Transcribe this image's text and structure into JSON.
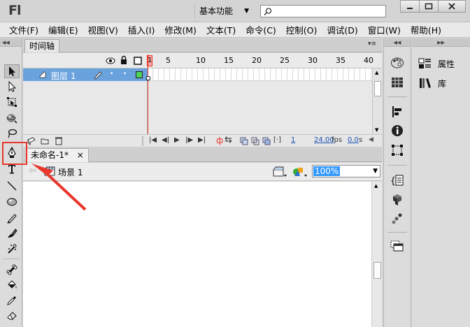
{
  "app": {
    "logo": "Fl"
  },
  "titlebar": {
    "workspace_label": "基本功能",
    "search_placeholder": ""
  },
  "menu": [
    "文件(F)",
    "编辑(E)",
    "视图(V)",
    "插入(I)",
    "修改(M)",
    "文本(T)",
    "命令(C)",
    "控制(O)",
    "调试(D)",
    "窗口(W)",
    "帮助(H)"
  ],
  "timeline": {
    "tab_label": "时间轴",
    "layer_name": "图层 1",
    "frame_ticks": [
      "1",
      "5",
      "10",
      "15",
      "20",
      "25",
      "30",
      "35",
      "40"
    ],
    "current_frame": "1",
    "fps": "24.00",
    "fps_unit": "fps",
    "time": "0.0",
    "time_unit": "s"
  },
  "document": {
    "tab_label": "未命名-1*",
    "scene_label": "场景 1",
    "zoom_value": "100%"
  },
  "right_panel": {
    "items": [
      {
        "icon": "properties-icon",
        "label": "属性"
      },
      {
        "icon": "library-icon",
        "label": "库"
      }
    ]
  },
  "colors": {
    "accent": "#6aa2de",
    "highlight": "#e8372c",
    "playhead": "#e8372c"
  }
}
